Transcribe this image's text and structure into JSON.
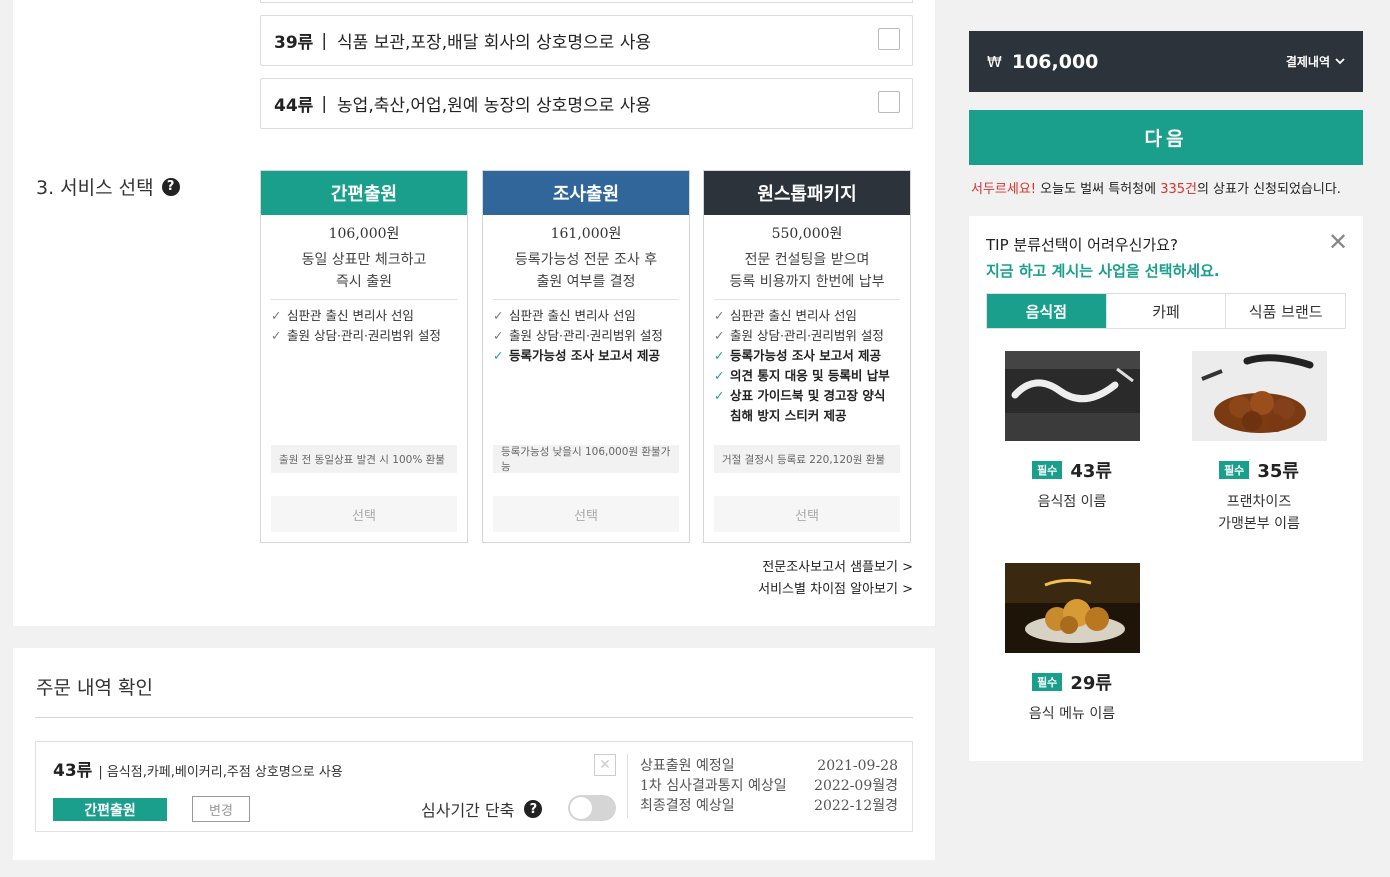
{
  "classes": [
    {
      "num": "39류",
      "sep": "|",
      "desc": "식품 보관,포장,배달 회사의 상호명으로 사용"
    },
    {
      "num": "44류",
      "sep": "|",
      "desc": "농업,축산,어업,원예 농장의 상호명으로 사용"
    }
  ],
  "service": {
    "title": "3. 서비스 선택",
    "help_glyph": "?",
    "cards": [
      {
        "name": "간편출원",
        "price": "106,000원",
        "desc1": "동일 상표만 체크하고",
        "desc2": "즉시 출원",
        "features": [
          "심판관 출신 변리사 선임",
          "출원 상담·관리·권리범위 설정"
        ],
        "note": "출원 전 동일상표 발견 시 100% 환불",
        "select": "선택",
        "color": "#1a9f8c"
      },
      {
        "name": "조사출원",
        "price": "161,000원",
        "desc1": "등록가능성 전문 조사 후",
        "desc2": "출원 여부를 결정",
        "features": [
          "심판관 출신 변리사 선임",
          "출원 상담·관리·권리범위 설정"
        ],
        "highlights": [
          "등록가능성 조사 보고서 제공"
        ],
        "note": "등록가능성 낮을시 106,000원 환불가능",
        "select": "선택",
        "color": "#30669a"
      },
      {
        "name": "원스톱패키지",
        "price": "550,000원",
        "desc1": "전문 컨설팅을 받으며",
        "desc2": "등록 비용까지 한번에 납부",
        "features": [
          "심판관 출신 변리사 선임",
          "출원 상담·관리·권리범위 설정"
        ],
        "highlights": [
          "등록가능성 조사 보고서 제공",
          "의견 통지 대응 및 등록비 납부",
          "상표 가이드북 및 경고장 양식",
          "침해 방지 스티커 제공"
        ],
        "note": "거절 결정시 등록료 220,120원 환불",
        "select": "선택",
        "color": "#2d333b"
      }
    ],
    "link_sample": "전문조사보고서 샘플보기 >",
    "link_diff": "서비스별 차이점 알아보기 >"
  },
  "order": {
    "title": "주문 내역 확인",
    "class_num": "43류",
    "class_desc": "| 음식점,카페,베이커리,주점 상호명으로 사용",
    "service_badge": "간편출원",
    "change": "변경",
    "close_glyph": "✕",
    "shorten_label": "심사기간 단축",
    "dates": [
      {
        "label": "상표출원 예정일",
        "value": "2021-09-28"
      },
      {
        "label": "1차 심사결과통지 예상일",
        "value": "2022-09월경"
      },
      {
        "label": "최종결정 예상일",
        "value": "2022-12월경"
      }
    ]
  },
  "sidebar": {
    "currency": "₩",
    "amount": "106,000",
    "history": "결제내역",
    "next": "다음",
    "hurry_red1": "서두르세요!",
    "hurry_mid": " 오늘도 벌써 특허청에 ",
    "hurry_red2": "335건",
    "hurry_end": "의 상표가 신청되었습니다.",
    "tip_q": "TIP 분류선택이 어려우신가요?",
    "tip_a": "지금 하고 계시는 사업을 선택하세요.",
    "close_glyph": "✕",
    "tabs": [
      "음식점",
      "카페",
      "식품 브랜드"
    ],
    "brands": [
      {
        "pill": "필수",
        "num": "43류",
        "label1": "음식점 이름",
        "label2": ""
      },
      {
        "pill": "필수",
        "num": "35류",
        "label1": "프랜차이즈",
        "label2": "가맹본부 이름"
      },
      {
        "pill": "필수",
        "num": "29류",
        "label1": "음식 메뉴 이름",
        "label2": ""
      }
    ]
  },
  "colors": {
    "teal": "#1a9f8c",
    "navy": "#30669a",
    "dark": "#2d333b",
    "red": "#d73232"
  }
}
